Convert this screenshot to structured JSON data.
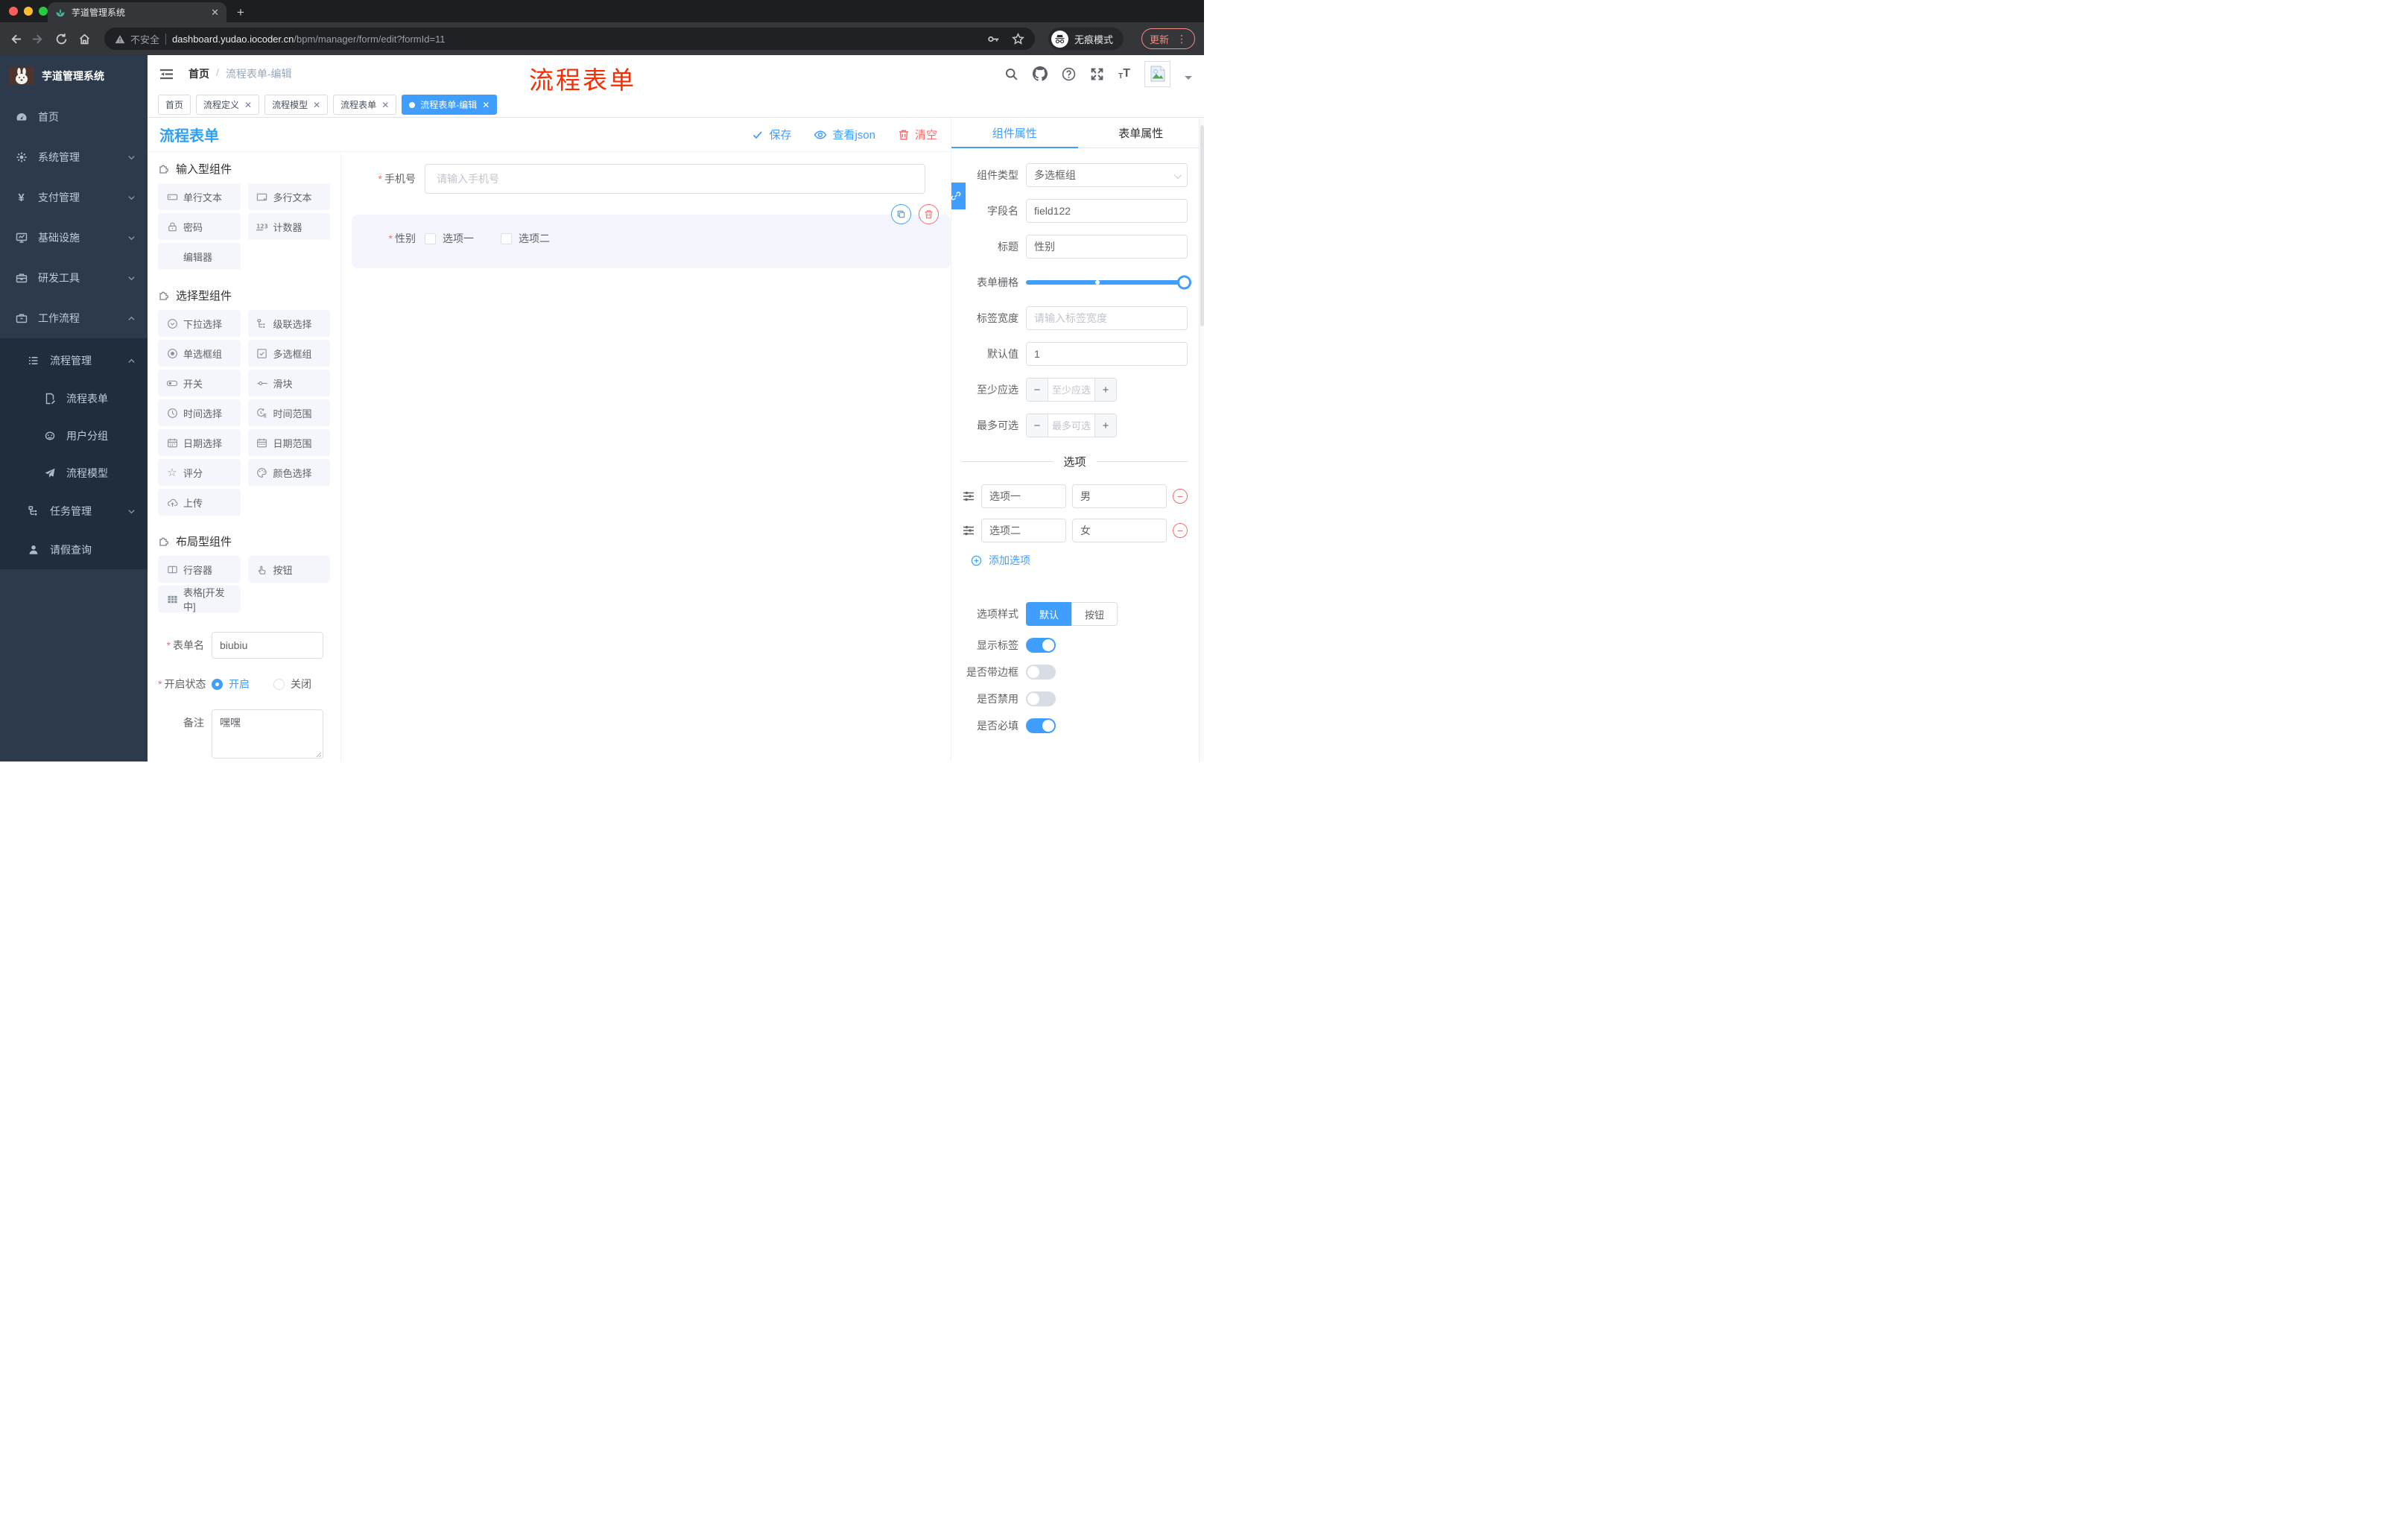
{
  "browser": {
    "tab_title": "芋道管理系统",
    "security_label": "不安全",
    "url_host": "dashboard.yudao.iocoder.cn",
    "url_path": "/bpm/manager/form/edit?formId=11",
    "incognito_label": "无痕模式",
    "update_label": "更新"
  },
  "annotation": {
    "text": "流程表单",
    "color": "#fc2b01"
  },
  "sidebar": {
    "logo_title": "芋道管理系统",
    "home": "首页",
    "system": "系统管理",
    "payment": "支付管理",
    "infra": "基础设施",
    "devtools": "研发工具",
    "workflow": "工作流程",
    "process_mgmt": "流程管理",
    "process_form": "流程表单",
    "user_group": "用户分组",
    "process_model": "流程模型",
    "task_mgmt": "任务管理",
    "leave_query": "请假查询"
  },
  "header": {
    "breadcrumb_home": "首页",
    "breadcrumb_sep": "/",
    "breadcrumb_current": "流程表单-编辑"
  },
  "tags": [
    {
      "label": "首页"
    },
    {
      "label": "流程定义"
    },
    {
      "label": "流程模型"
    },
    {
      "label": "流程表单"
    },
    {
      "label": "流程表单-编辑"
    }
  ],
  "designer": {
    "title": "流程表单",
    "save_label": "保存",
    "view_json_label": "查看json",
    "clear_label": "清空",
    "input_components": {
      "title": "输入型组件",
      "items": [
        "单行文本",
        "多行文本",
        "密码",
        "计数器",
        "编辑器"
      ]
    },
    "select_components": {
      "title": "选择型组件",
      "items": [
        "下拉选择",
        "级联选择",
        "单选框组",
        "多选框组",
        "开关",
        "滑块",
        "时间选择",
        "时间范围",
        "日期选择",
        "日期范围",
        "评分",
        "颜色选择",
        "上传"
      ]
    },
    "layout_components": {
      "title": "布局型组件",
      "items": [
        "行容器",
        "按钮",
        "表格[开发中]"
      ]
    },
    "form_meta": {
      "name_label": "表单名",
      "name_value": "biubiu",
      "status_label": "开启状态",
      "status_on": "开启",
      "status_off": "关闭",
      "remark_label": "备注",
      "remark_value": "嘿嘿"
    },
    "canvas": {
      "phone_label": "手机号",
      "phone_placeholder": "请输入手机号",
      "gender_label": "性别",
      "gender_option1": "选项一",
      "gender_option2": "选项二"
    }
  },
  "props": {
    "tab_component": "组件属性",
    "tab_form": "表单属性",
    "component_type_label": "组件类型",
    "component_type_value": "多选框组",
    "field_name_label": "字段名",
    "field_name_value": "field122",
    "title_label": "标题",
    "title_value": "性别",
    "grid_label": "表单栅格",
    "label_width_label": "标签宽度",
    "label_width_placeholder": "请输入标签宽度",
    "default_label": "默认值",
    "default_value": "1",
    "min_label": "至少应选",
    "min_placeholder": "至少应选",
    "max_label": "最多可选",
    "max_placeholder": "最多可选",
    "options_title": "选项",
    "option1_name": "选项一",
    "option1_value": "男",
    "option2_name": "选项二",
    "option2_value": "女",
    "add_option_label": "添加选项",
    "style_label": "选项样式",
    "style_default": "默认",
    "style_button": "按钮",
    "show_label": "显示标签",
    "border_label": "是否带边框",
    "disabled_label": "是否禁用",
    "required_label": "是否必填"
  },
  "colors": {
    "primary": "#409eff",
    "danger": "#f56c6c",
    "title_blue": "#2d9ff5",
    "sidebar_bg": "#2d3a4b",
    "submenu_bg": "#1f2d3d",
    "annotation_red": "#fc2b01"
  }
}
